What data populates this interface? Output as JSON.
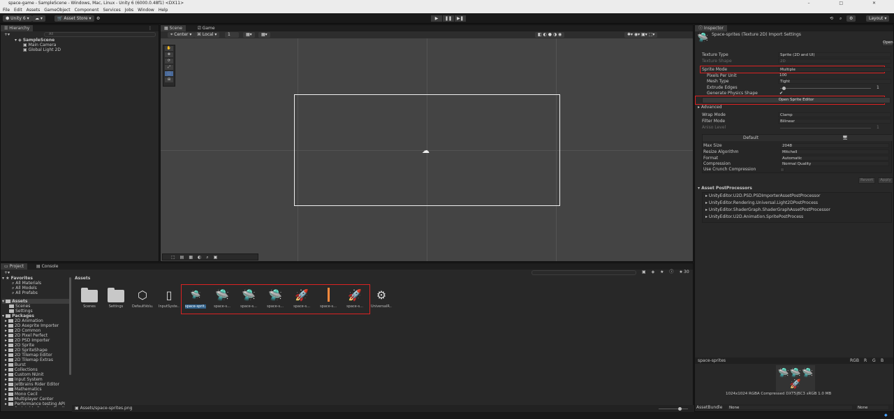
{
  "window": {
    "title": "space-game - SampleScene - Windows, Mac, Linux - Unity 6 (6000.0.48f1) <DX11>",
    "controls": [
      "–",
      "□",
      "✕"
    ]
  },
  "menu": [
    "File",
    "Edit",
    "Assets",
    "GameObject",
    "Component",
    "Services",
    "Jobs",
    "Window",
    "Help"
  ],
  "toolbar": {
    "account": "Unity 6",
    "asset_store": "Asset Store",
    "play": "▶",
    "pause": "❚❚",
    "step": "▶❚",
    "layout": "Layout"
  },
  "hierarchy": {
    "tab": "Hierarchy",
    "search_placeholder": "All",
    "scene": "SampleScene",
    "items": [
      "Main Camera",
      "Global Light 2D"
    ]
  },
  "scene": {
    "tab_scene": "Scene",
    "tab_game": "Game",
    "pivot": "Center",
    "space": "Local",
    "snap_value": "1"
  },
  "inspector": {
    "tab": "Inspector",
    "title": "Space-sprites (Texture 2D) Import Settings",
    "open_button": "Open",
    "texture_type_label": "Texture Type",
    "texture_type_value": "Sprite (2D and UI)",
    "texture_shape_label": "Texture Shape",
    "texture_shape_value": "2D",
    "sprite_mode_label": "Sprite Mode",
    "sprite_mode_value": "Multiple",
    "ppu_label": "Pixels Per Unit",
    "ppu_value": "100",
    "mesh_type_label": "Mesh Type",
    "mesh_type_value": "Tight",
    "extrude_label": "Extrude Edges",
    "extrude_value": "1",
    "extrude_fraction": 0.02,
    "physics_label": "Generate Physics Shape",
    "open_sprite_editor": "Open Sprite Editor",
    "advanced": "Advanced",
    "wrap_label": "Wrap Mode",
    "wrap_value": "Clamp",
    "filter_label": "Filter Mode",
    "filter_value": "Bilinear",
    "aniso_label": "Aniso Level",
    "aniso_value": "1",
    "platform_default": "Default",
    "max_size_label": "Max Size",
    "max_size_value": "2048",
    "resize_label": "Resize Algorithm",
    "resize_value": "Mitchell",
    "format_label": "Format",
    "format_value": "Automatic",
    "compression_label": "Compression",
    "compression_value": "Normal Quality",
    "crunch_label": "Use Crunch Compression",
    "revert": "Revert",
    "apply": "Apply",
    "postprocessors_title": "Asset PostProcessors",
    "postprocessors": [
      "UnityEditor.U2D.PSD.PSDImporterAssetPostProcessor",
      "UnityEditor.Rendering.Universal.Light2DPostProcess",
      "UnityEditor.ShaderGraph.ShaderGraphAssetPostProcessor",
      "UnityEditor.U2D.Animation.SpritePostProcess"
    ],
    "preview_name": "space-sprites",
    "preview_channels": [
      "RGB",
      "R",
      "G",
      "B"
    ],
    "preview_info": "1024x1024  RGBA Compressed DXT5|BC3 sRGB   1.0 MB",
    "assetbundle_label": "AssetBundle",
    "assetbundle_value": "None",
    "assetbundle_variant": "None"
  },
  "project": {
    "tab_project": "Project",
    "tab_console": "Console",
    "favorites_title": "Favorites",
    "favorites": [
      "All Materials",
      "All Models",
      "All Prefabs"
    ],
    "assets_title": "Assets",
    "asset_folders": [
      "Scenes",
      "Settings"
    ],
    "packages_title": "Packages",
    "packages": [
      "2D Animation",
      "2D Aseprite Importer",
      "2D Common",
      "2D Pixel Perfect",
      "2D PSD Importer",
      "2D Sprite",
      "2D SpriteShape",
      "2D Tilemap Editor",
      "2D Tilemap Extras",
      "Burst",
      "Collections",
      "Custom NUnit",
      "Input System",
      "JetBrains Rider Editor",
      "Mathematics",
      "Mono Cecil",
      "Multiplayer Center",
      "Performance testing API",
      "Scriptable Render Pipeline",
      "Searcher"
    ],
    "breadcrumb": "Assets",
    "hidden_count": "30",
    "items": [
      {
        "label": "Scenes",
        "icon": "folder"
      },
      {
        "label": "Settings",
        "icon": "folder"
      },
      {
        "label": "DefaultVolu...",
        "icon": "cube"
      },
      {
        "label": "InputSyste...",
        "icon": "doc"
      },
      {
        "label": "space-sprit...",
        "icon": "sprites"
      },
      {
        "label": "space-s...",
        "icon": "🛸"
      },
      {
        "label": "space-s...",
        "icon": "🛸"
      },
      {
        "label": "space-s...",
        "icon": "🛸"
      },
      {
        "label": "space-s...",
        "icon": "🚀"
      },
      {
        "label": "space-s...",
        "icon": "laser"
      },
      {
        "label": "space-s...",
        "icon": "🚀"
      },
      {
        "label": "UniversalR...",
        "icon": "gear"
      }
    ],
    "status_path": "Assets/space-sprites.png"
  }
}
